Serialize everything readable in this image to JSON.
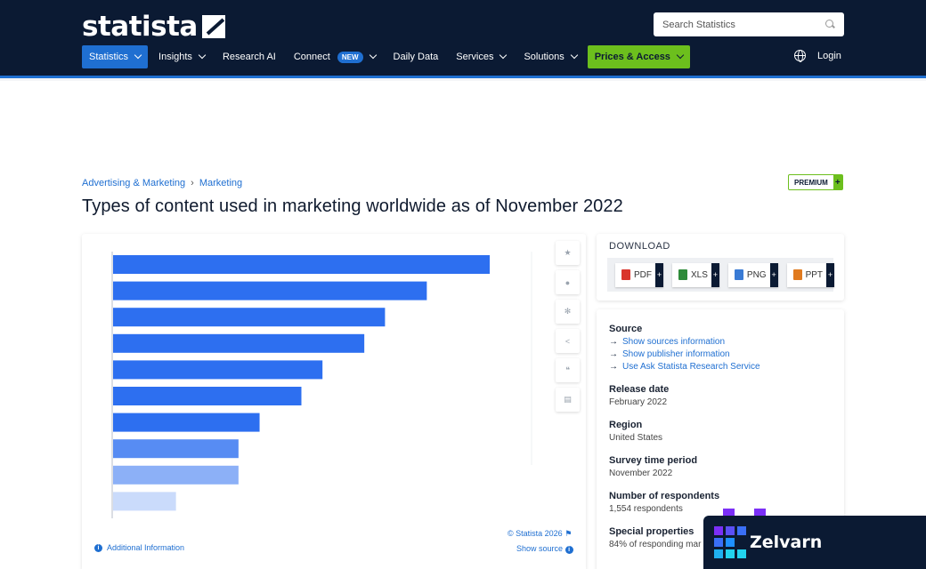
{
  "header": {
    "logo_text": "statista",
    "search_placeholder": "Search Statistics",
    "nav": [
      {
        "label": "Statistics",
        "dropdown": true,
        "active": true
      },
      {
        "label": "Insights",
        "dropdown": true
      },
      {
        "label": "Research AI",
        "dropdown": false
      },
      {
        "label": "Connect",
        "dropdown": true,
        "badge": "NEW"
      },
      {
        "label": "Daily Data",
        "dropdown": false
      },
      {
        "label": "Services",
        "dropdown": true
      },
      {
        "label": "Solutions",
        "dropdown": true
      },
      {
        "label": "Prices & Access",
        "dropdown": true
      }
    ],
    "login_label": "Login"
  },
  "breadcrumb": {
    "items": [
      "Advertising & Marketing",
      "Marketing"
    ],
    "separator": "›"
  },
  "premium_label": "PREMIUM",
  "page_title": "Types of content used in marketing worldwide as of November 2022",
  "chart_data": {
    "type": "bar",
    "orientation": "horizontal",
    "categories": [
      "",
      "",
      "",
      "",
      "",
      "",
      "",
      "",
      "",
      ""
    ],
    "values": [
      100,
      83.3,
      72.2,
      66.7,
      55.6,
      50,
      38.9,
      33.3,
      33.3,
      16.7
    ],
    "bar_color": "#2d6ff0",
    "fading_bars": true
  },
  "chart_footer": {
    "copyright": "© Statista 2026",
    "show_source": "Show source",
    "additional_info": "Additional Information"
  },
  "download": {
    "title": "DOWNLOAD",
    "buttons": [
      {
        "label": "PDF",
        "color": "#d9342b"
      },
      {
        "label": "XLS",
        "color": "#2e8b3a"
      },
      {
        "label": "PNG",
        "color": "#3a7bd5"
      },
      {
        "label": "PPT",
        "color": "#e07a1f"
      }
    ]
  },
  "info": {
    "source_title": "Source",
    "source_links": [
      "Show sources information",
      "Show publisher information",
      "Use Ask Statista Research Service"
    ],
    "release_title": "Release date",
    "release_value": "February 2022",
    "region_title": "Region",
    "region_value": "United States",
    "survey_title": "Survey time period",
    "survey_value": "November 2022",
    "respondents_title": "Number of respondents",
    "respondents_value": "1,554 respondents",
    "special_title": "Special properties",
    "special_value": "84% of responding mar"
  },
  "overlay": {
    "brand": "Zelvarn"
  },
  "colors": {
    "header_bg": "#0b1a33",
    "accent_blue": "#1f6fd1",
    "accent_green": "#6cbf1d"
  }
}
